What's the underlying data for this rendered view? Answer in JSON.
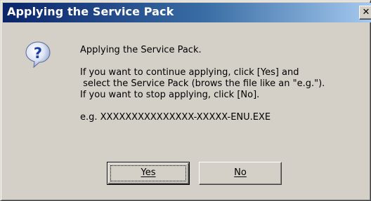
{
  "window": {
    "title": "Applying the Service Pack",
    "close_glyph": "✕"
  },
  "icon": "question-icon",
  "message": {
    "line1": "Applying the Service Pack.",
    "line2": "If you want to continue applying, click [Yes] and",
    "line3": " select the Service Pack (brows the file like an \"e.g.\").",
    "line4": "If you want to stop applying, click [No].",
    "line5": "e.g. XXXXXXXXXXXXXXX-XXXXX-ENU.EXE"
  },
  "buttons": {
    "yes_label": "Yes",
    "no_label": "No"
  },
  "colors": {
    "title_start": "#0a246a",
    "title_end": "#a6caf0",
    "face": "#d4d0c8"
  }
}
